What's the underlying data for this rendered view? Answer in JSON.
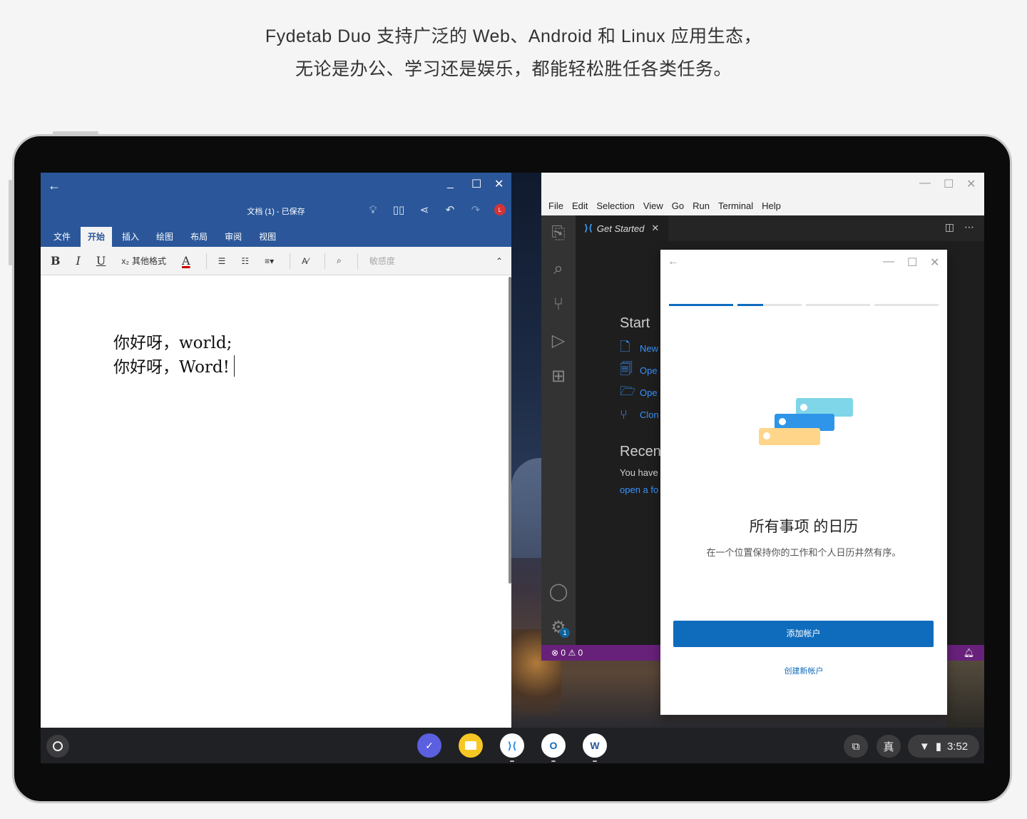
{
  "caption": {
    "line1": "Fydetab Duo 支持广泛的 Web、Android 和 Linux 应用生态，",
    "line2": "无论是办公、学习还是娱乐，都能轻松胜任各类任务。"
  },
  "word": {
    "doc_title": "文档 (1) - 已保存",
    "tabs": [
      "文件",
      "开始",
      "插入",
      "绘图",
      "布局",
      "审阅",
      "视图"
    ],
    "active_tab": "开始",
    "ribbon": {
      "bold": "B",
      "italic": "I",
      "underline": "U",
      "subscript": "x₂",
      "other_format": "其他格式",
      "font_color": "A",
      "sensitivity": "敏感度"
    },
    "avatar_letter": "L",
    "body_line1": "你好呀，world;",
    "body_line2": "你好呀，Word!"
  },
  "vscode": {
    "menu": [
      "File",
      "Edit",
      "Selection",
      "View",
      "Go",
      "Run",
      "Terminal",
      "Help"
    ],
    "tab_label": "Get Started",
    "start_heading": "Start",
    "start_links": [
      "New",
      "Ope",
      "Ope",
      "Clon"
    ],
    "recent_heading": "Recen",
    "recent_text": "You have",
    "recent_link": "open a fo",
    "status_errors": "0",
    "status_warnings": "0",
    "settings_badge": "1"
  },
  "outlook": {
    "title": "所有事项 的日历",
    "subtitle": "在一个位置保持你的工作和个人日历井然有序。",
    "primary_button": "添加帐户",
    "secondary_link": "创建新帐户",
    "accent": "#0f6cbd"
  },
  "shelf": {
    "ime": "真",
    "time": "3:52"
  },
  "colors": {
    "word_blue": "#2b579a",
    "vscode_status": "#68217a"
  }
}
